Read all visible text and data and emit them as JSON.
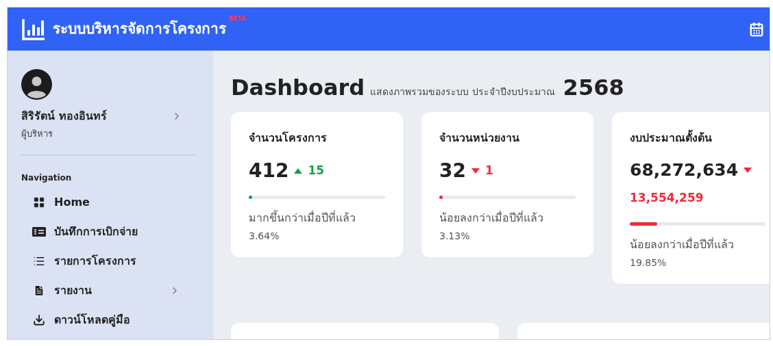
{
  "header": {
    "title": "ระบบบริหารจัดการโครงการ",
    "badge": "BETA"
  },
  "sidebar": {
    "user": {
      "name": "สิริรัตน์ ทองอินทร์",
      "role": "ผู้บริหาร"
    },
    "section": "Navigation",
    "items": [
      {
        "label": "Home",
        "has_submenu": false
      },
      {
        "label": "บันทึกการเบิกจ่าย",
        "has_submenu": false
      },
      {
        "label": "รายการโครงการ",
        "has_submenu": false
      },
      {
        "label": "รายงาน",
        "has_submenu": true
      },
      {
        "label": "ดาวน์โหลดคู่มือ",
        "has_submenu": false
      }
    ]
  },
  "page": {
    "title": "Dashboard",
    "subtitle": "แสดงภาพรวมของระบบ ประจำปีงบประมาณ",
    "year": "2568"
  },
  "cards": [
    {
      "kind": "inline",
      "title": "จำนวนโครงการ",
      "value": "412",
      "increase": true,
      "delta": "15",
      "level": 0.02,
      "note": "มากขึ้นกว่าเมื่อปีที่แล้ว",
      "percent": "3.64%"
    },
    {
      "kind": "inline",
      "title": "จำนวนหน่วยงาน",
      "value": "32",
      "increase": false,
      "delta": "1",
      "level": 0.01,
      "note": "น้อยลงกว่าเมื่อปีที่แล้ว",
      "percent": "3.13%"
    },
    {
      "kind": "stacked",
      "title": "งบประมาณตั้งต้น",
      "value": "68,272,634",
      "increase": false,
      "delta": "13,554,259",
      "level": 0.2,
      "note": "น้อยลงกว่าเมื่อปีที่แล้ว",
      "percent": "19.85%"
    }
  ]
}
